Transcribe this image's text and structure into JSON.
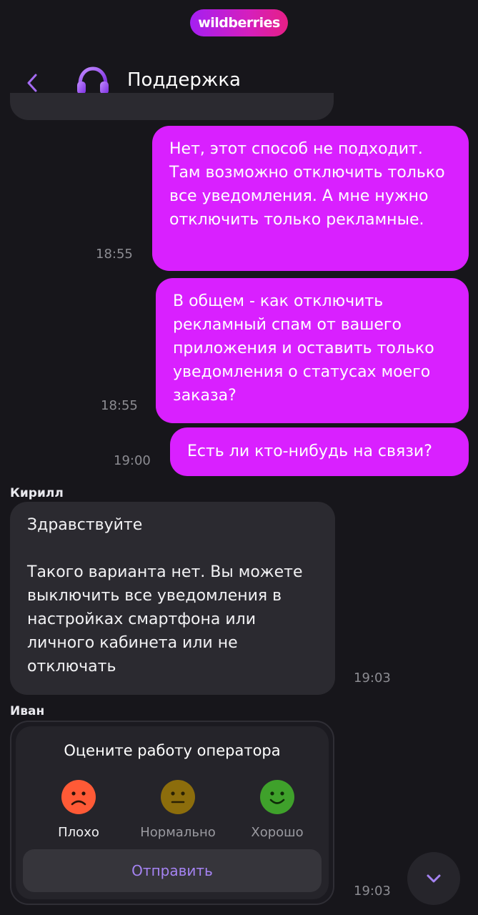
{
  "brand": {
    "logo_text": "wildberries"
  },
  "header": {
    "title": "Поддержка"
  },
  "messages": {
    "out1": {
      "text": "Нет, этот способ не подходит. Там возможно отключить только все уведомления. А мне нужно отключить только рекламные.",
      "time": "18:55"
    },
    "out2": {
      "text": "В общем - как отключить рекламный спам от вашего приложения и оставить только уведомления о статусах моего заказа?",
      "time": "18:55"
    },
    "out3": {
      "text": "Есть ли кто-нибудь на связи?",
      "time": "19:00"
    },
    "in1": {
      "sender": "Кирилл",
      "greeting": "Здравствуйте",
      "text": "Такого варианта нет. Вы можете выключить все уведомления в настройках смартфона или личного кабинета или не отключать",
      "time": "19:03"
    }
  },
  "rating": {
    "sender": "Иван",
    "title": "Оцените работу оператора",
    "options": [
      {
        "label": "Плохо",
        "color": "#ff5a36",
        "icon": "sad-face-icon"
      },
      {
        "label": "Нормально",
        "color": "#8c6d0c",
        "icon": "neutral-face-icon"
      },
      {
        "label": "Хорошо",
        "color": "#3fa12b",
        "icon": "smile-face-icon"
      }
    ],
    "send_label": "Отправить",
    "time": "19:03"
  },
  "colors": {
    "accent": "#d920ff",
    "background": "#17161b",
    "bubble_in": "#2b2a30"
  }
}
